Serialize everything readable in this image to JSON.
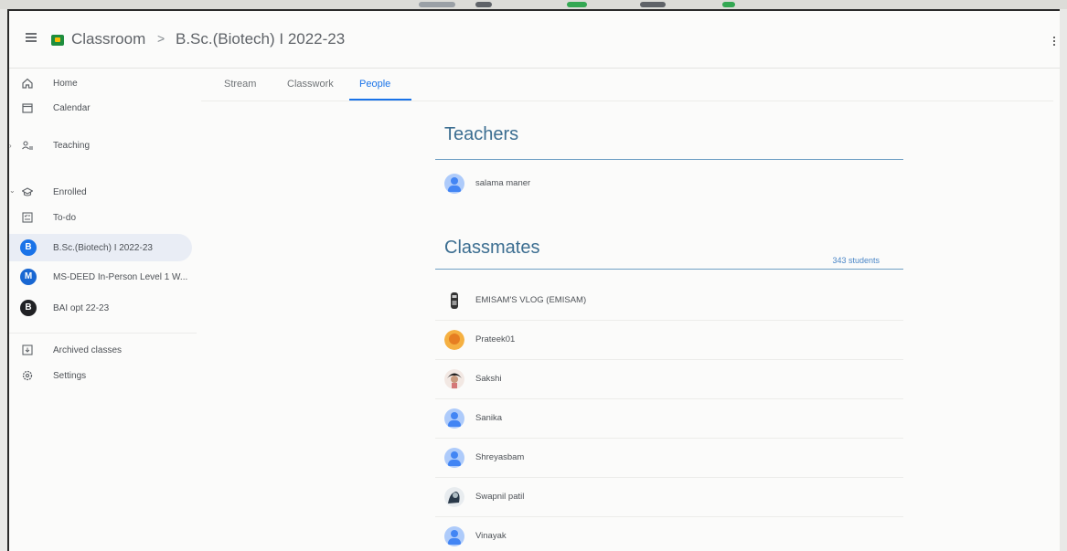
{
  "header": {
    "app_title": "Classroom",
    "breadcrumb_separator": ">",
    "class_name": "B.Sc.(Biotech) I 2022-23"
  },
  "tabs": [
    {
      "label": "Stream",
      "active": false
    },
    {
      "label": "Classwork",
      "active": false
    },
    {
      "label": "People",
      "active": true
    }
  ],
  "sidebar": {
    "items": [
      {
        "label": "Home",
        "icon": "home-icon"
      },
      {
        "label": "Calendar",
        "icon": "calendar-icon"
      },
      {
        "label": "Teaching",
        "icon": "teaching-icon"
      },
      {
        "label": "Enrolled",
        "icon": "enrolled-icon"
      },
      {
        "label": "To-do",
        "icon": "todo-icon"
      },
      {
        "label": "B.Sc.(Biotech) I 2022-23",
        "avatar": "B",
        "color": "#1a73e8",
        "selected": true
      },
      {
        "label": "MS-DEED In-Person Level 1 W...",
        "avatar": "M",
        "color": "#1967d2"
      },
      {
        "label": "BAI opt 22-23",
        "avatar": "B",
        "color": "#202124"
      },
      {
        "label": "Archived classes",
        "icon": "archive-icon"
      },
      {
        "label": "Settings",
        "icon": "settings-icon"
      }
    ]
  },
  "teachers": {
    "title": "Teachers",
    "list": [
      {
        "name": "salama maner"
      }
    ]
  },
  "classmates": {
    "title": "Classmates",
    "count": "343 students",
    "list": [
      {
        "name": "EMISAM'S VLOG (EMISAM)"
      },
      {
        "name": "Prateek01"
      },
      {
        "name": "Sakshi"
      },
      {
        "name": "Sanika"
      },
      {
        "name": "Shreyasbam"
      },
      {
        "name": "Swapnil patil"
      },
      {
        "name": "Vinayak"
      }
    ]
  },
  "colors": {
    "accent": "#1a73e8",
    "section_title": "#3c6e91"
  }
}
